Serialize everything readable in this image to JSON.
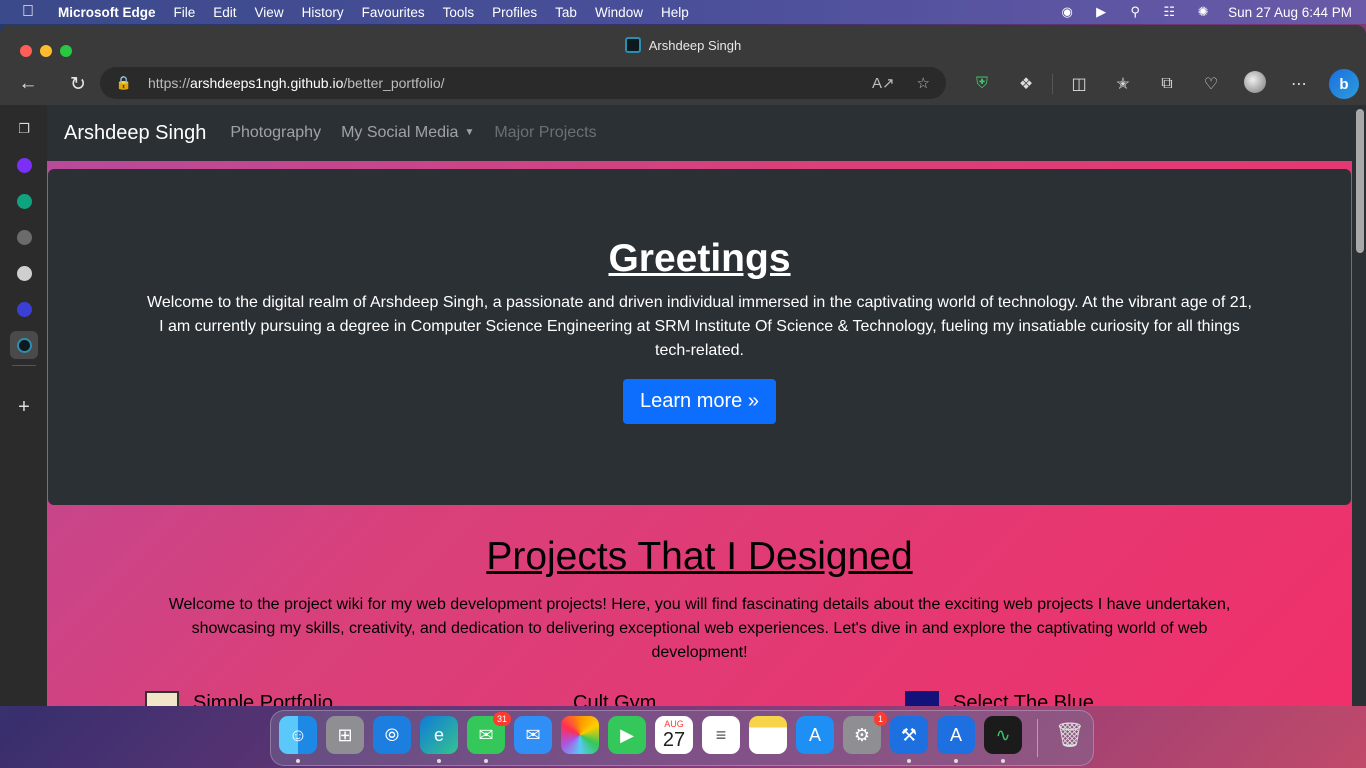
{
  "menubar": {
    "app_name": "Microsoft Edge",
    "items": [
      "File",
      "Edit",
      "View",
      "History",
      "Favourites",
      "Tools",
      "Profiles",
      "Tab",
      "Window",
      "Help"
    ],
    "clock": "Sun 27 Aug  6:44 PM"
  },
  "browser": {
    "tab_title": "Arshdeep Singh",
    "url_scheme": "https://",
    "url_host": "arshdeeps1ngh.github.io",
    "url_path": "/better_portfolio/"
  },
  "site": {
    "brand": "Arshdeep Singh",
    "nav": {
      "photography": "Photography",
      "social": "My Social Media",
      "projects": "Major Projects"
    },
    "hero": {
      "title": "Greetings",
      "text": "Welcome to the digital realm of Arshdeep Singh, a passionate and driven individual immersed in the captivating world of technology. At the vibrant age of 21, I am currently pursuing a degree in Computer Science Engineering at SRM Institute Of Science & Technology, fueling my insatiable curiosity for all things tech-related.",
      "button": "Learn more »"
    },
    "projects": {
      "title": "Projects That I Designed",
      "text": "Welcome to the project wiki for my web development projects! Here, you will find fascinating details about the exciting web projects I have undertaken, showcasing my skills, creativity, and dedication to delivering exceptional web experiences. Let's dive in and explore the captivating world of web development!",
      "items": [
        "Simple Portfolio",
        "Cult Gym",
        "Select The Blue"
      ]
    }
  },
  "dock": {
    "messages_badge": "31",
    "calendar_month": "AUG",
    "calendar_day": "27",
    "settings_badge": "1"
  }
}
